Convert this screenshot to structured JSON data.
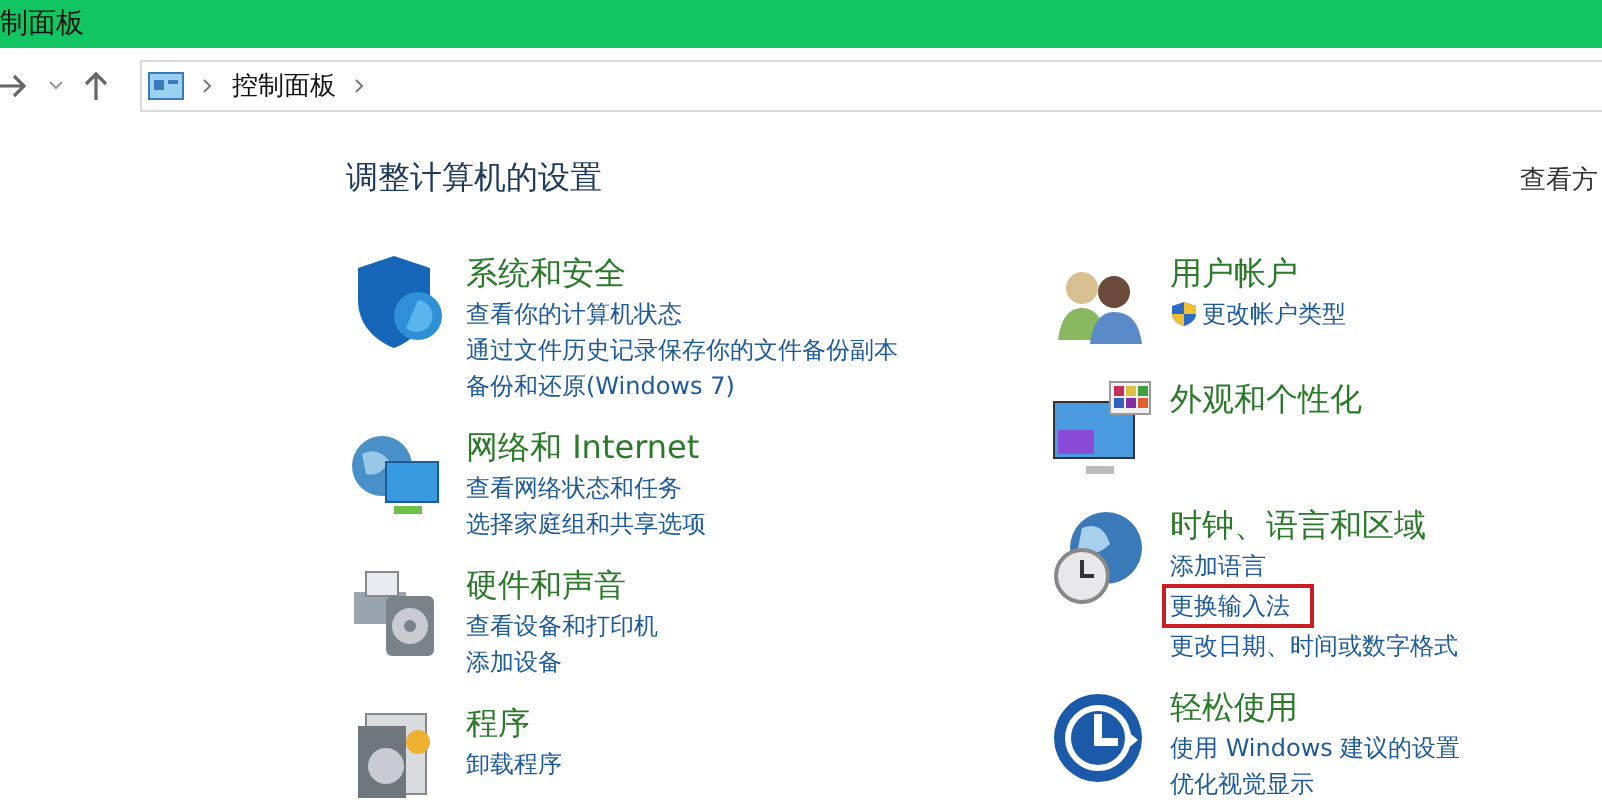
{
  "window": {
    "title": "制面板"
  },
  "address_bar": {
    "segments": [
      "控制面板"
    ]
  },
  "heading": "调整计算机的设置",
  "view_by": "查看方",
  "columns": [
    {
      "categories": [
        {
          "kind": "shield",
          "title": "系统和安全",
          "links": [
            {
              "text": "查看你的计算机状态",
              "highlighted": false
            },
            {
              "text": "通过文件历史记录保存你的文件备份副本",
              "highlighted": false
            },
            {
              "text": "备份和还原(Windows 7)",
              "highlighted": false
            }
          ]
        },
        {
          "kind": "network",
          "title": "网络和 Internet",
          "links": [
            {
              "text": "查看网络状态和任务",
              "highlighted": false
            },
            {
              "text": "选择家庭组和共享选项",
              "highlighted": false
            }
          ]
        },
        {
          "kind": "printer",
          "title": "硬件和声音",
          "links": [
            {
              "text": "查看设备和打印机",
              "highlighted": false
            },
            {
              "text": "添加设备",
              "highlighted": false
            }
          ]
        },
        {
          "kind": "programs",
          "title": "程序",
          "links": [
            {
              "text": "卸载程序",
              "highlighted": false
            }
          ]
        }
      ]
    },
    {
      "categories": [
        {
          "kind": "users",
          "title": "用户帐户",
          "links": [
            {
              "text": "更改帐户类型",
              "highlighted": false,
              "shield": true
            }
          ]
        },
        {
          "kind": "monitor",
          "title": "外观和个性化"
        },
        {
          "kind": "clock",
          "title": "时钟、语言和区域",
          "links": [
            {
              "text": "添加语言",
              "highlighted": false
            },
            {
              "text": "更换输入法",
              "highlighted": true
            },
            {
              "text": "更改日期、时间或数字格式",
              "highlighted": false
            }
          ]
        },
        {
          "kind": "ease",
          "title": "轻松使用",
          "links": [
            {
              "text": "使用 Windows 建议的设置",
              "highlighted": false
            },
            {
              "text": "优化视觉显示",
              "highlighted": false
            }
          ]
        }
      ]
    }
  ]
}
